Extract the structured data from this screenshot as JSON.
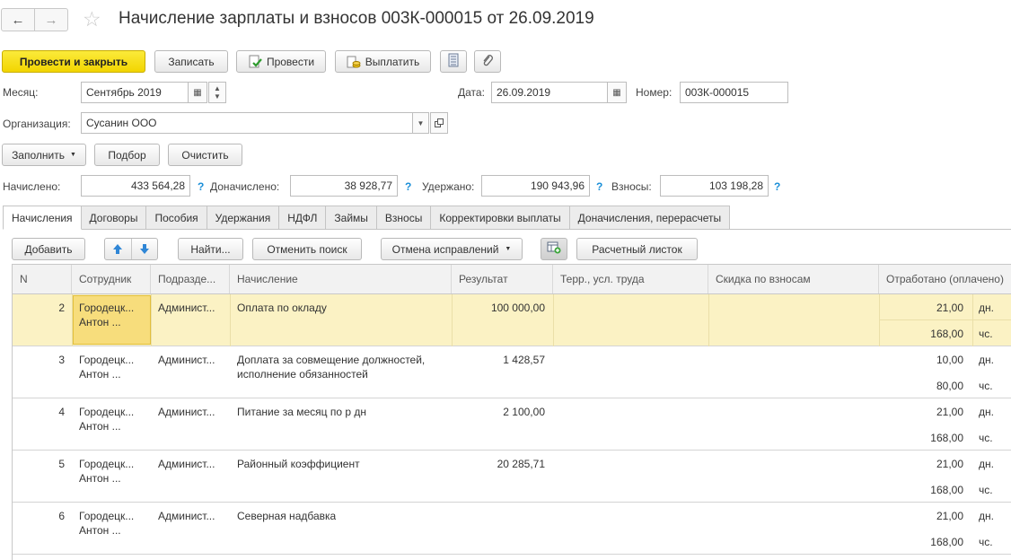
{
  "window": {
    "title": "Начисление зарплаты и взносов 003К-000015 от 26.09.2019",
    "back_icon": "arrow-left",
    "forward_icon": "arrow-right",
    "favorite_icon": "star"
  },
  "toolbar": {
    "post_close": "Провести и закрыть",
    "save": "Записать",
    "post": "Провести",
    "pay": "Выплатить"
  },
  "header": {
    "month_label": "Месяц:",
    "month_value": "Сентябрь 2019",
    "date_label": "Дата:",
    "date_value": "26.09.2019",
    "number_label": "Номер:",
    "number_value": "003К-000015",
    "org_label": "Организация:",
    "org_value": "Сусанин ООО"
  },
  "actions": {
    "fill": "Заполнить",
    "pick": "Подбор",
    "clear": "Очистить"
  },
  "totals": {
    "accrued_label": "Начислено:",
    "accrued_value": "433 564,28",
    "additional_label": "Доначислено:",
    "additional_value": "38 928,77",
    "withheld_label": "Удержано:",
    "withheld_value": "190 943,96",
    "contrib_label": "Взносы:",
    "contrib_value": "103 198,28",
    "help": "?"
  },
  "tabs": [
    "Начисления",
    "Договоры",
    "Пособия",
    "Удержания",
    "НДФЛ",
    "Займы",
    "Взносы",
    "Корректировки выплаты",
    "Доначисления, перерасчеты"
  ],
  "grid_toolbar": {
    "add": "Добавить",
    "find": "Найти...",
    "cancel_search": "Отменить поиск",
    "cancel_corrections": "Отмена исправлений",
    "payslip": "Расчетный листок"
  },
  "grid": {
    "columns": [
      "N",
      "Сотрудник",
      "Подразде...",
      "Начисление",
      "Результат",
      "Терр., усл. труда",
      "Скидка по взносам",
      "Отработано (оплачено)"
    ],
    "rows": [
      {
        "n": "2",
        "emp1": "Городецк...",
        "emp2": "Антон ...",
        "dept": "Админист...",
        "acc1": "Оплата по окладу",
        "acc2": "",
        "result": "100 000,00",
        "days": "21,00",
        "days_unit": "дн.",
        "hours": "168,00",
        "hours_unit": "чс."
      },
      {
        "n": "3",
        "emp1": "Городецк...",
        "emp2": "Антон ...",
        "dept": "Админист...",
        "acc1": "Доплата за совмещение должностей,",
        "acc2": "исполнение обязанностей",
        "result": "1 428,57",
        "days": "10,00",
        "days_unit": "дн.",
        "hours": "80,00",
        "hours_unit": "чс."
      },
      {
        "n": "4",
        "emp1": "Городецк...",
        "emp2": "Антон ...",
        "dept": "Админист...",
        "acc1": "Питание за месяц по р дн",
        "acc2": "",
        "result": "2 100,00",
        "days": "21,00",
        "days_unit": "дн.",
        "hours": "168,00",
        "hours_unit": "чс."
      },
      {
        "n": "5",
        "emp1": "Городецк...",
        "emp2": "Антон ...",
        "dept": "Админист...",
        "acc1": "Районный коэффициент",
        "acc2": "",
        "result": "20 285,71",
        "days": "21,00",
        "days_unit": "дн.",
        "hours": "168,00",
        "hours_unit": "чс."
      },
      {
        "n": "6",
        "emp1": "Городецк...",
        "emp2": "Антон ...",
        "dept": "Админист...",
        "acc1": "Северная надбавка",
        "acc2": "",
        "result": "",
        "days": "21,00",
        "days_unit": "дн.",
        "hours": "168,00",
        "hours_unit": "чс."
      }
    ]
  }
}
